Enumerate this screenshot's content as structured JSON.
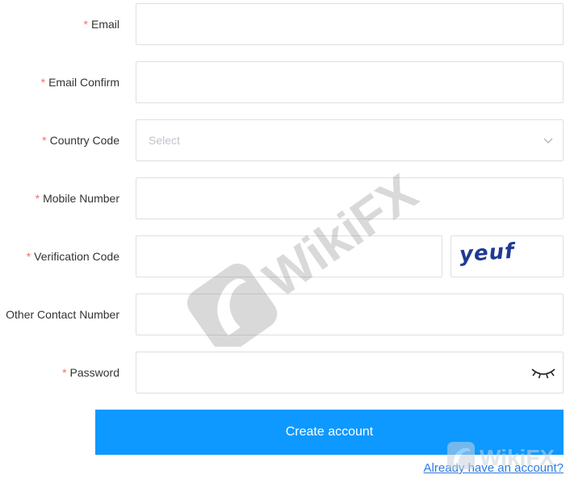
{
  "form": {
    "required_mark": "*",
    "email": {
      "label": "Email",
      "value": "",
      "placeholder": ""
    },
    "email_confirm": {
      "label": "Email Confirm",
      "value": "",
      "placeholder": ""
    },
    "country_code": {
      "label": "Country Code",
      "selected": "Select"
    },
    "mobile_number": {
      "label": "Mobile Number",
      "value": "",
      "placeholder": ""
    },
    "verification_code": {
      "label": "Verification Code",
      "value": "",
      "placeholder": "",
      "captcha_text": "yeuf"
    },
    "other_contact": {
      "label": "Other Contact Number",
      "value": "",
      "placeholder": ""
    },
    "password": {
      "label": "Password",
      "value": "",
      "placeholder": "",
      "toggle_icon": "eye-closed-icon"
    },
    "submit_label": "Create account",
    "login_link": "Already have an account?"
  },
  "watermark": {
    "text": "WikiFX"
  },
  "colors": {
    "accent": "#0d99ff",
    "required": "#f56c6c",
    "link": "#2f7bdb",
    "border": "#dcdfe6",
    "placeholder": "#c0c4cc"
  }
}
